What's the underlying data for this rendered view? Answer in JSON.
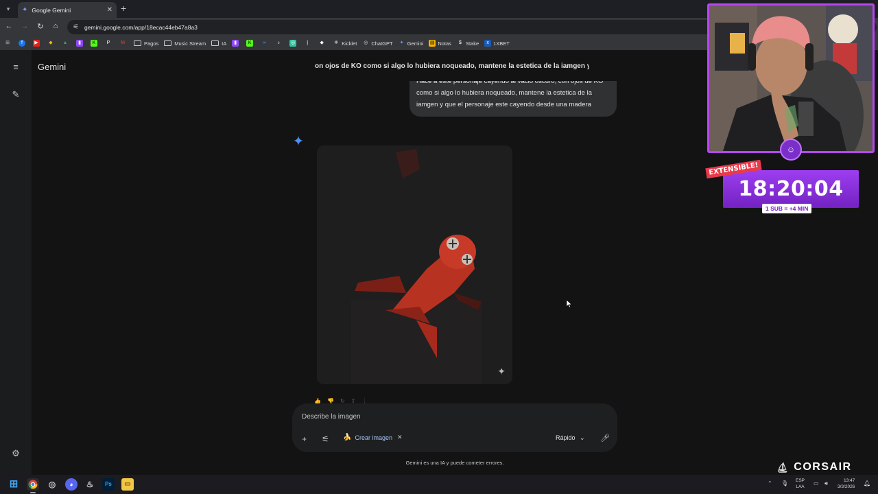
{
  "browser": {
    "tab_title": "Google Gemini",
    "url": "gemini.google.com/app/18ecac44eb47a8a3",
    "bookmarks": [
      "Pagos",
      "Music Stream",
      "IA",
      "Kicklet",
      "ChatGPT",
      "Gemini",
      "Notas",
      "Stake",
      "1XBET"
    ]
  },
  "app": {
    "brand": "Gemini",
    "conversation_title": "on ojos de KO como si algo lo hubiera noqueado, mantene la estetica de la iamgen y c",
    "prompt_text": "Hace a este personaje cayendo al vacio oscuro, con ojos de KO como si algo lo hubiera noqueado, mantene la estetica de la iamgen y que el personaje este cayendo desde una madera",
    "composer_placeholder": "Describe la imagen",
    "chip_label": "Crear imagen",
    "mode_label": "Rápido",
    "disclaimer": "Gemini es una IA y puede cometer errores."
  },
  "overlay": {
    "timer": "18:20:04",
    "badge": "EXTENSIBLE!",
    "sub_rule": "1 SUB = +4 MIN",
    "sponsor": "CORSAIR",
    "accent": "#9d3ef0"
  },
  "taskbar": {
    "lang_top": "ESP",
    "lang_bottom": "LAA",
    "time": "13:47",
    "date": "3/3/2026"
  }
}
